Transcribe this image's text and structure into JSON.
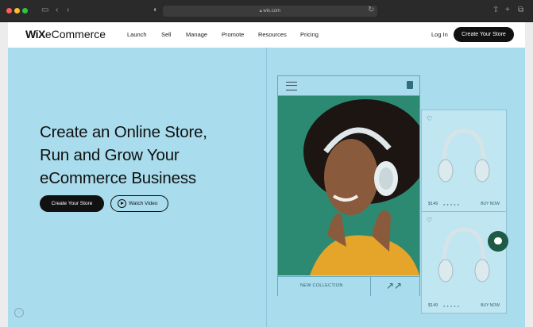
{
  "browser": {
    "url": "wix.com"
  },
  "nav": {
    "logo_bold": "WiX",
    "logo_rest": "eCommerce",
    "items": [
      "Launch",
      "Sell",
      "Manage",
      "Promote",
      "Resources",
      "Pricing"
    ],
    "login": "Log In",
    "cta": "Create Your Store"
  },
  "hero": {
    "title_lines": [
      "Create an Online Store,",
      "Run and Grow Your",
      "eCommerce Business"
    ],
    "primary_button": "Create Your Store",
    "secondary_button": "Watch Video"
  },
  "product_card": {
    "collection_label": "NEW COLLECTION"
  },
  "side_products": [
    {
      "price": "$149",
      "buy": "BUY NOW"
    },
    {
      "price": "$149",
      "buy": "BUY NOW"
    }
  ],
  "colors": {
    "hero_bg": "#a9dcec",
    "button_dark": "#111111",
    "chat_bubble": "#1f5a46"
  }
}
